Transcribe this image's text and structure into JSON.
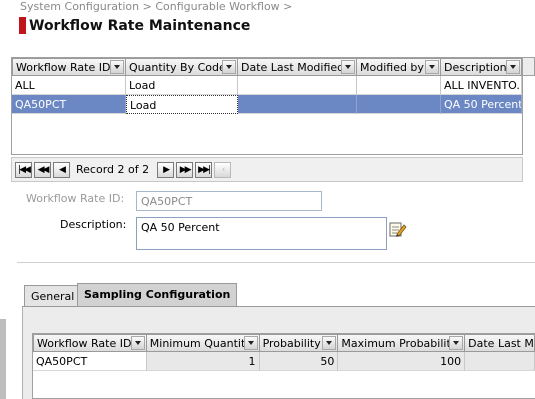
{
  "breadcrumb": "System Configuration > Configurable Workflow >",
  "title": "Workflow Rate Maintenance",
  "top_grid": {
    "columns": [
      "Workflow Rate ID",
      "Quantity By Code",
      "Date Last Modified",
      "Modified by",
      "Description"
    ],
    "rows": [
      {
        "workflow_rate_id": "ALL",
        "quantity_by_code": "Load",
        "date_last_modified": "",
        "modified_by": "",
        "description": "ALL INVENTO..."
      },
      {
        "workflow_rate_id": "QA50PCT",
        "quantity_by_code": "Load",
        "date_last_modified": "",
        "modified_by": "",
        "description": "QA 50 Percent"
      }
    ],
    "selected_row": 1
  },
  "pager": {
    "record_text": "Record 2 of 2",
    "first_icon": "first-record-icon",
    "prev_page_icon": "previous-page-icon",
    "prev_icon": "previous-record-icon",
    "next_icon": "next-record-icon",
    "next_page_icon": "next-page-icon",
    "last_icon": "last-record-icon",
    "extra_icon": "chevron-left-icon"
  },
  "form": {
    "workflow_rate_id_label": "Workflow Rate ID:",
    "workflow_rate_id_value": "QA50PCT",
    "description_label": "Description:",
    "description_value": "QA 50 Percent",
    "edit_icon": "edit-note-icon"
  },
  "tabs": [
    {
      "label": "General",
      "active": false
    },
    {
      "label": "Sampling Configuration",
      "active": true
    }
  ],
  "sampling_grid": {
    "columns": [
      "Workflow Rate ID",
      "Minimum Quantity",
      "Probability",
      "Maximum Probability",
      "Date Last Modi"
    ],
    "rows": [
      {
        "workflow_rate_id": "QA50PCT",
        "minimum_quantity": "1",
        "probability": "50",
        "maximum_probability": "100",
        "date_last_modified": ""
      }
    ]
  },
  "colors": {
    "selected_row": "#6b87c4",
    "title_marker": "#c0161b",
    "disabled_label": "#9a9a9a"
  }
}
